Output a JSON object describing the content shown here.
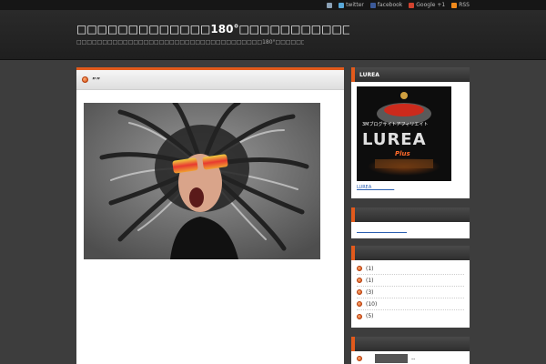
{
  "topbar": {
    "links": [
      {
        "label": "",
        "icon": "home-icon",
        "color": "#8aa0b5"
      },
      {
        "label": "twitter",
        "icon": "twitter-icon",
        "color": "#59a8d8"
      },
      {
        "label": "facebook",
        "icon": "facebook-icon",
        "color": "#3b5998"
      },
      {
        "label": "Google +1",
        "icon": "google-plus-icon",
        "color": "#d2432f"
      },
      {
        "label": "RSS",
        "icon": "rss-icon",
        "color": "#f08a1c"
      }
    ]
  },
  "header": {
    "title": "□□□□□□□□□□□□□180°□□□□□□□□□□□□□□□□□□□□□□□□□",
    "description": "□□□□□□□□□□□□□□□□□□□□□□□□□□□□□□□□□□□□180°□□□□□□□□□□□□□□□□□□□□□□□□□"
  },
  "post": {
    "title": "””"
  },
  "sidebar": {
    "widget1": {
      "title": "LUREA",
      "ad_text_top": "3Mブログサイトアフィリエイト",
      "ad_text_main": "LUREA",
      "ad_text_sub": "Plus",
      "link": "LUREA　　　　　"
    },
    "widget2": {
      "title": "",
      "link": "　　　　　　　　　　　"
    },
    "widget3": {
      "title": "",
      "items": [
        "(1)",
        "(1)",
        "(3)",
        "(10)",
        "(5)"
      ]
    },
    "widget4": {
      "title": "",
      "item": "--"
    }
  },
  "colors": {
    "accent": "#e25a1c",
    "link": "#2b5fb0"
  }
}
